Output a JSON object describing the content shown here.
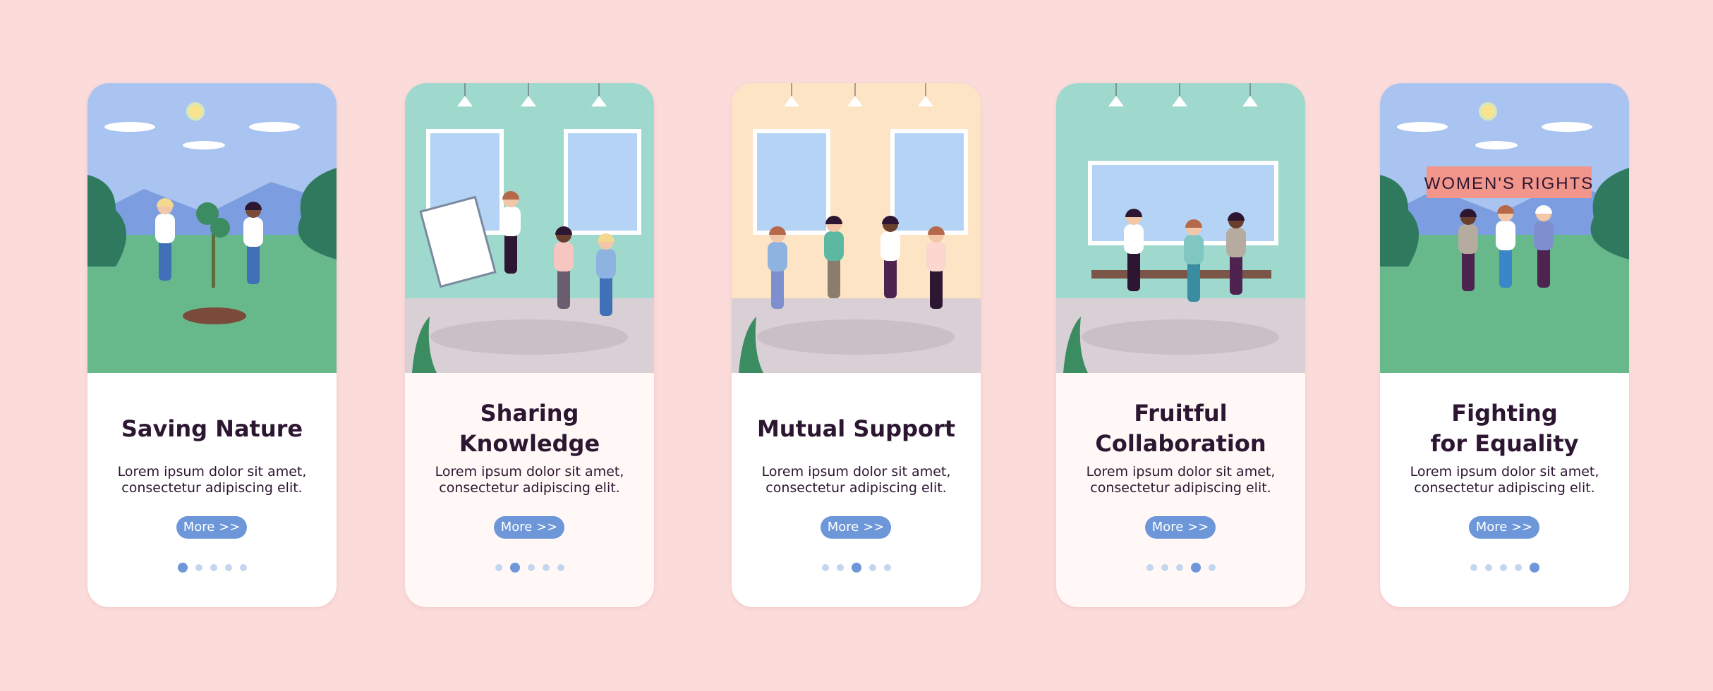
{
  "colors": {
    "background": "#fbdcdb",
    "accent": "#6d97d8",
    "dot_inactive": "#c4d6ef",
    "title": "#2c1631"
  },
  "cards": [
    {
      "title": "Saving Nature",
      "body": "Lorem ipsum dolor sit amet,\nconsectetur adipiscing elit.",
      "button": "More >>",
      "active_dot": 0,
      "scene": "outdoor-planting"
    },
    {
      "title": "Sharing\nKnowledge",
      "body": "Lorem ipsum dolor sit amet,\nconsectetur adipiscing elit.",
      "button": "More >>",
      "active_dot": 1,
      "scene": "indoor-presentation"
    },
    {
      "title": "Mutual Support",
      "body": "Lorem ipsum dolor sit amet,\nconsectetur adipiscing elit.",
      "button": "More >>",
      "active_dot": 2,
      "scene": "indoor-support-circle"
    },
    {
      "title": "Fruitful\nCollaboration",
      "body": "Lorem ipsum dolor sit amet,\nconsectetur adipiscing elit.",
      "button": "More >>",
      "active_dot": 3,
      "scene": "indoor-meeting-table"
    },
    {
      "title": "Fighting\nfor Equality",
      "body": "Lorem ipsum dolor sit amet,\nconsectetur adipiscing elit.",
      "button": "More >>",
      "active_dot": 4,
      "scene": "outdoor-protest",
      "banner": "WOMEN'S RIGHTS"
    }
  ],
  "dot_count": 5
}
